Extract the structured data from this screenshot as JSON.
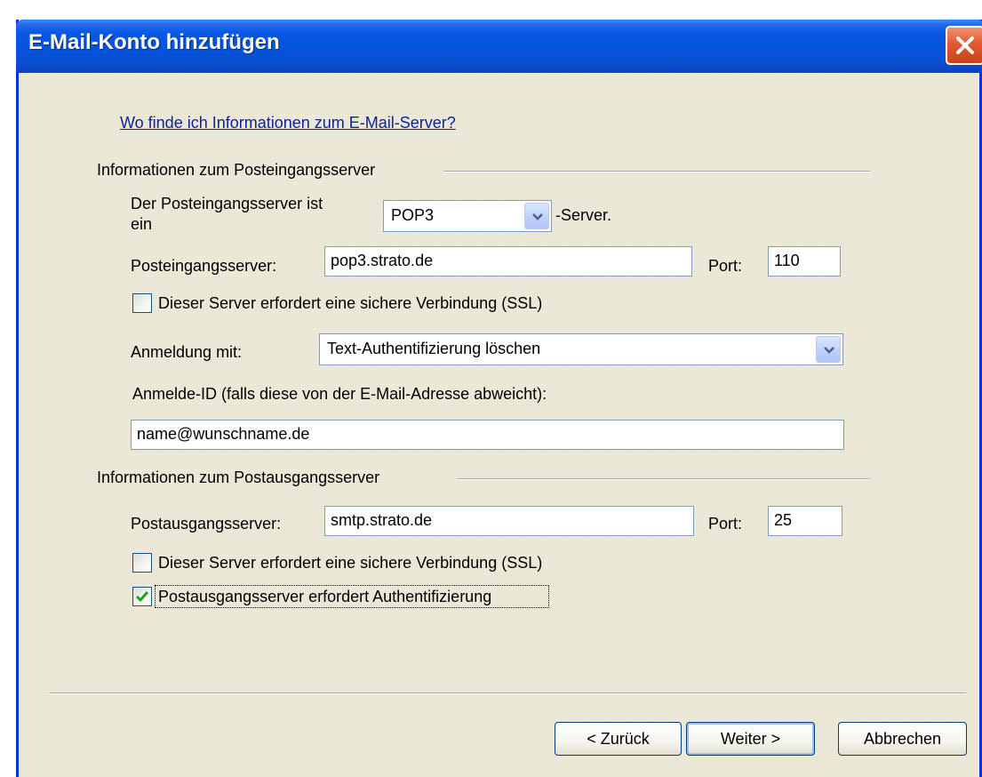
{
  "window": {
    "title": "E-Mail-Konto hinzufügen"
  },
  "help_link": "Wo finde ich Informationen zum E-Mail-Server?",
  "incoming": {
    "group_title": "Informationen zum Posteingangsserver",
    "server_type_label_line1": "Der Posteingangsserver ist",
    "server_type_label_line2": "ein",
    "server_type_value": "POP3",
    "server_type_suffix": "-Server.",
    "server_label": "Posteingangsserver:",
    "server_value": "pop3.strato.de",
    "port_label": "Port:",
    "port_value": "110",
    "ssl_label": "Dieser Server erfordert eine sichere Verbindung (SSL)",
    "ssl_checked": false,
    "login_label": "Anmeldung mit:",
    "login_value": "Text-Authentifizierung löschen",
    "login_id_label": "Anmelde-ID (falls diese von der E-Mail-Adresse abweicht):",
    "login_id_value": "name@wunschname.de"
  },
  "outgoing": {
    "group_title": "Informationen zum Postausgangsserver",
    "server_label": "Postausgangsserver:",
    "server_value": "smtp.strato.de",
    "port_label": "Port:",
    "port_value": "25",
    "ssl_label": "Dieser Server erfordert eine sichere Verbindung (SSL)",
    "ssl_checked": false,
    "auth_label": "Postausgangsserver erfordert Authentifizierung",
    "auth_checked": true
  },
  "buttons": {
    "back": "< Zurück",
    "next": "Weiter >",
    "cancel": "Abbrechen"
  },
  "icons": {
    "close": "close-icon",
    "dropdown": "chevron-down-icon",
    "check": "checkmark-icon"
  },
  "colors": {
    "titlebar": "#0453dd",
    "dialog_bg": "#ece9d8",
    "link": "#0a2596",
    "close_button": "#e25a30",
    "checkmark": "#21a121"
  }
}
